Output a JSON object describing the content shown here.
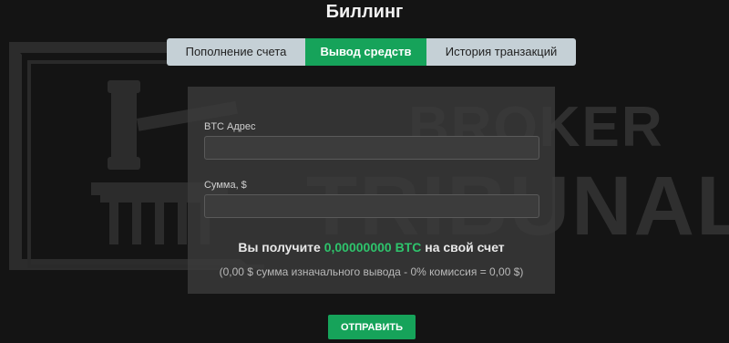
{
  "page": {
    "title": "Биллинг"
  },
  "tabs": [
    {
      "label": "Пополнение счета",
      "active": false
    },
    {
      "label": "Вывод средств",
      "active": true
    },
    {
      "label": "История транзакций",
      "active": false
    }
  ],
  "form": {
    "btc_address": {
      "label": "BTC Адрес",
      "value": ""
    },
    "amount": {
      "label": "Сумма, $",
      "value": ""
    }
  },
  "summary": {
    "prefix": "Вы получите",
    "amount": "0,00000000 BTC",
    "suffix": "на свой счет",
    "detail": "(0,00 $ сумма изначального вывода - 0% комиссия = 0,00 $)"
  },
  "submit": {
    "label": "ОТПРАВИТЬ"
  },
  "watermark": {
    "line1": "BROKER",
    "line2": "TRIBUNAL"
  },
  "colors": {
    "accent": "#16a35a",
    "tab_bg": "#c5d0d6",
    "background": "#141414",
    "highlight": "#2ec46c"
  }
}
